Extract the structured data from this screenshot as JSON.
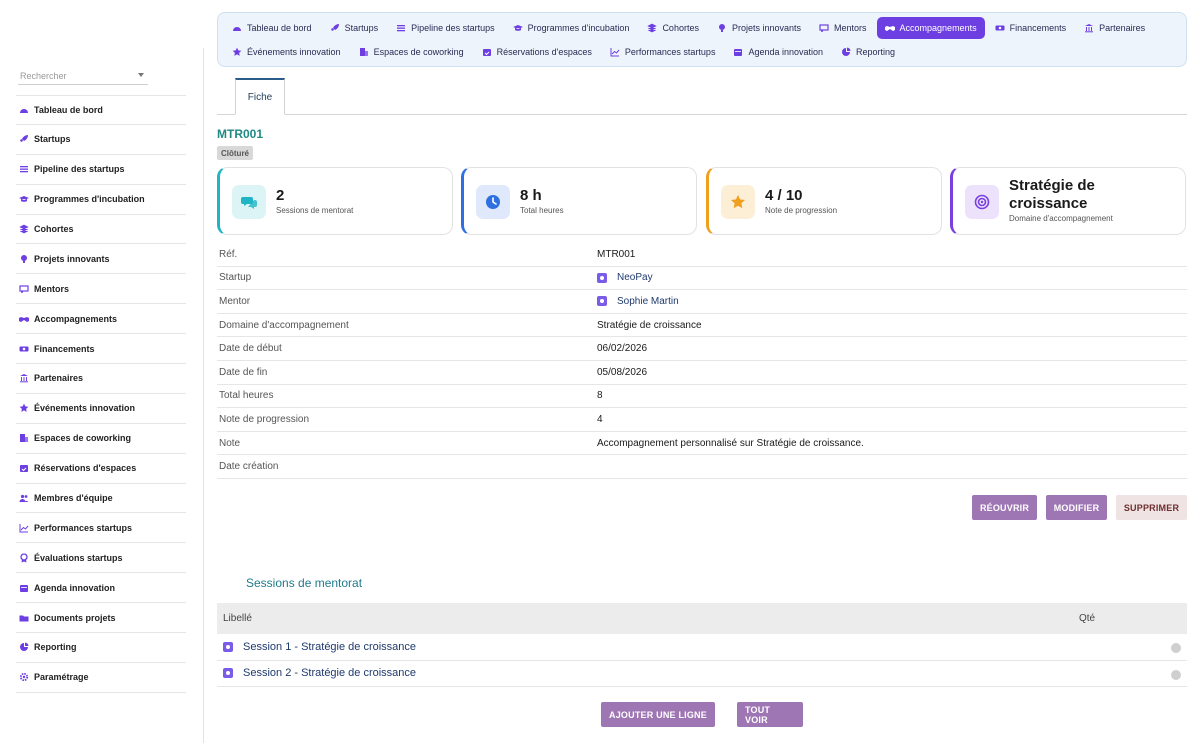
{
  "sidebar": {
    "search_placeholder": "Rechercher",
    "items": [
      {
        "label": "Tableau de bord",
        "icon": "dashboard-icon"
      },
      {
        "label": "Startups",
        "icon": "rocket-icon"
      },
      {
        "label": "Pipeline des startups",
        "icon": "list-icon"
      },
      {
        "label": "Programmes d'incubation",
        "icon": "graduation-cap-icon"
      },
      {
        "label": "Cohortes",
        "icon": "layers-icon"
      },
      {
        "label": "Projets innovants",
        "icon": "lightbulb-icon"
      },
      {
        "label": "Mentors",
        "icon": "chalkboard-icon"
      },
      {
        "label": "Accompagnements",
        "icon": "handshake-icon"
      },
      {
        "label": "Financements",
        "icon": "money-icon"
      },
      {
        "label": "Partenaires",
        "icon": "bank-icon"
      },
      {
        "label": "Événements innovation",
        "icon": "star-icon"
      },
      {
        "label": "Espaces de coworking",
        "icon": "building-icon"
      },
      {
        "label": "Réservations d'espaces",
        "icon": "calendar-check-icon"
      },
      {
        "label": "Membres d'équipe",
        "icon": "users-icon"
      },
      {
        "label": "Performances startups",
        "icon": "chart-line-icon"
      },
      {
        "label": "Évaluations startups",
        "icon": "award-icon"
      },
      {
        "label": "Agenda innovation",
        "icon": "calendar-icon"
      },
      {
        "label": "Documents projets",
        "icon": "folder-icon"
      },
      {
        "label": "Reporting",
        "icon": "pie-chart-icon"
      },
      {
        "label": "Paramétrage",
        "icon": "gear-icon"
      }
    ]
  },
  "topnav": {
    "row1": [
      "Tableau de bord",
      "Startups",
      "Pipeline des startups",
      "Programmes d'incubation",
      "Cohortes",
      "Projets innovants",
      "Mentors",
      "Accompagnements",
      "Financements",
      "Partenaires"
    ],
    "row2": [
      "Événements innovation",
      "Espaces de coworking",
      "Réservations d'espaces",
      "Performances startups",
      "Agenda innovation",
      "Reporting"
    ],
    "active": "Accompagnements"
  },
  "tab": {
    "label": "Fiche"
  },
  "record": {
    "ref": "MTR001",
    "status": "Clôturé"
  },
  "kpis": [
    {
      "value": "2",
      "label": "Sessions de mentorat",
      "icon": "chat-icon",
      "color": "#1fb5c4"
    },
    {
      "value": "8 h",
      "label": "Total heures",
      "icon": "clock-icon",
      "color": "#2f6fe0"
    },
    {
      "value": "4 / 10",
      "label": "Note de progression",
      "icon": "star-icon",
      "color": "#f0a020"
    },
    {
      "value": "Stratégie de croissance",
      "label": "Domaine d'accompagnement",
      "icon": "target-icon",
      "color": "#7a3fe0"
    }
  ],
  "details": [
    {
      "key": "Réf.",
      "value": "MTR001"
    },
    {
      "key": "Startup",
      "value": "NeoPay",
      "link": true
    },
    {
      "key": "Mentor",
      "value": "Sophie Martin",
      "link": true
    },
    {
      "key": "Domaine d'accompagnement",
      "value": "Stratégie de croissance"
    },
    {
      "key": "Date de début",
      "value": "06/02/2026"
    },
    {
      "key": "Date de fin",
      "value": "05/08/2026"
    },
    {
      "key": "Total heures",
      "value": "8"
    },
    {
      "key": "Note de progression",
      "value": "4"
    },
    {
      "key": "Note",
      "value": "Accompagnement personnalisé sur Stratégie de croissance."
    },
    {
      "key": "Date création",
      "value": ""
    }
  ],
  "actions": {
    "reopen": "RÉOUVRIR",
    "edit": "MODIFIER",
    "delete": "SUPPRIMER"
  },
  "sessions": {
    "title": "Sessions de mentorat",
    "col_label": "Libellé",
    "col_qty": "Qté",
    "rows": [
      "Session 1 - Stratégie de croissance",
      "Session 2 - Stratégie de croissance"
    ],
    "add_line": "AJOUTER UNE LIGNE",
    "see_all": "TOUT VOIR"
  }
}
